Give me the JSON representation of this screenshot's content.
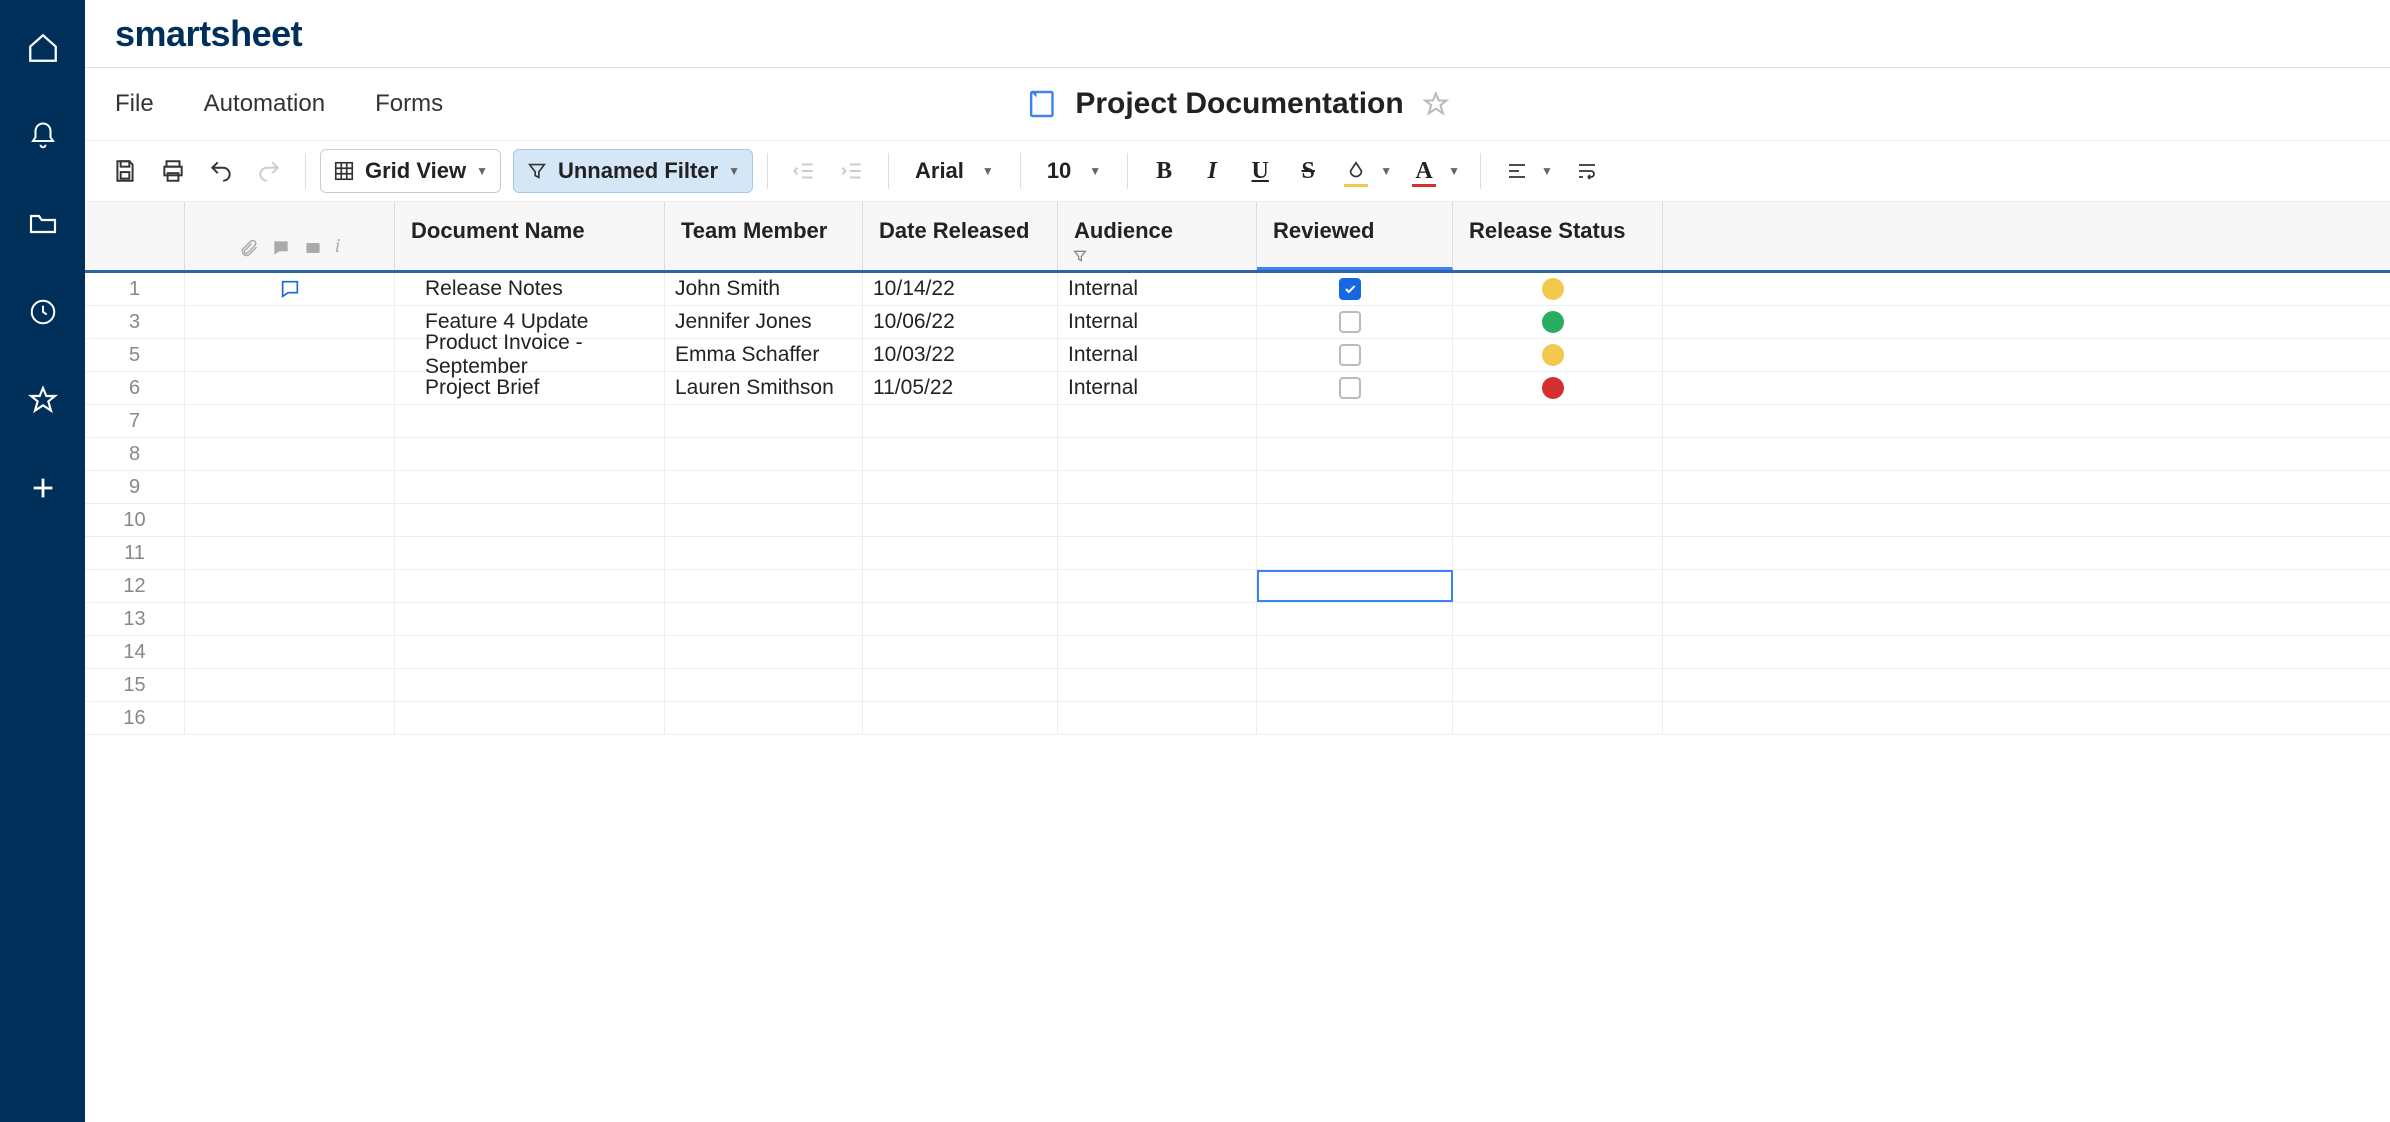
{
  "brand": "smartsheet",
  "menu": {
    "file": "File",
    "automation": "Automation",
    "forms": "Forms"
  },
  "sheet": {
    "title": "Project Documentation"
  },
  "toolbar": {
    "view_label": "Grid View",
    "filter_label": "Unnamed Filter",
    "font_name": "Arial",
    "font_size": "10"
  },
  "columns": {
    "doc": "Document Name",
    "team": "Team Member",
    "date": "Date Released",
    "aud": "Audience",
    "rev": "Reviewed",
    "status": "Release Status"
  },
  "rows": [
    {
      "num": "1",
      "has_comment": true,
      "doc": "Release Notes",
      "team": "John Smith",
      "date": "10/14/22",
      "aud": "Internal",
      "reviewed": true,
      "status": "yellow"
    },
    {
      "num": "3",
      "has_comment": false,
      "doc": "Feature 4 Update",
      "team": "Jennifer Jones",
      "date": "10/06/22",
      "aud": "Internal",
      "reviewed": false,
      "status": "green"
    },
    {
      "num": "5",
      "has_comment": false,
      "doc": "Product Invoice - September",
      "team": "Emma Schaffer",
      "date": "10/03/22",
      "aud": "Internal",
      "reviewed": false,
      "status": "yellow"
    },
    {
      "num": "6",
      "has_comment": false,
      "doc": "Project Brief",
      "team": "Lauren Smithson",
      "date": "11/05/22",
      "aud": "Internal",
      "reviewed": false,
      "status": "red"
    }
  ],
  "empty_rows": [
    "7",
    "8",
    "9",
    "10",
    "11",
    "12",
    "13",
    "14",
    "15",
    "16"
  ],
  "selected_cell": {
    "row_num": "12",
    "col": "rev"
  }
}
